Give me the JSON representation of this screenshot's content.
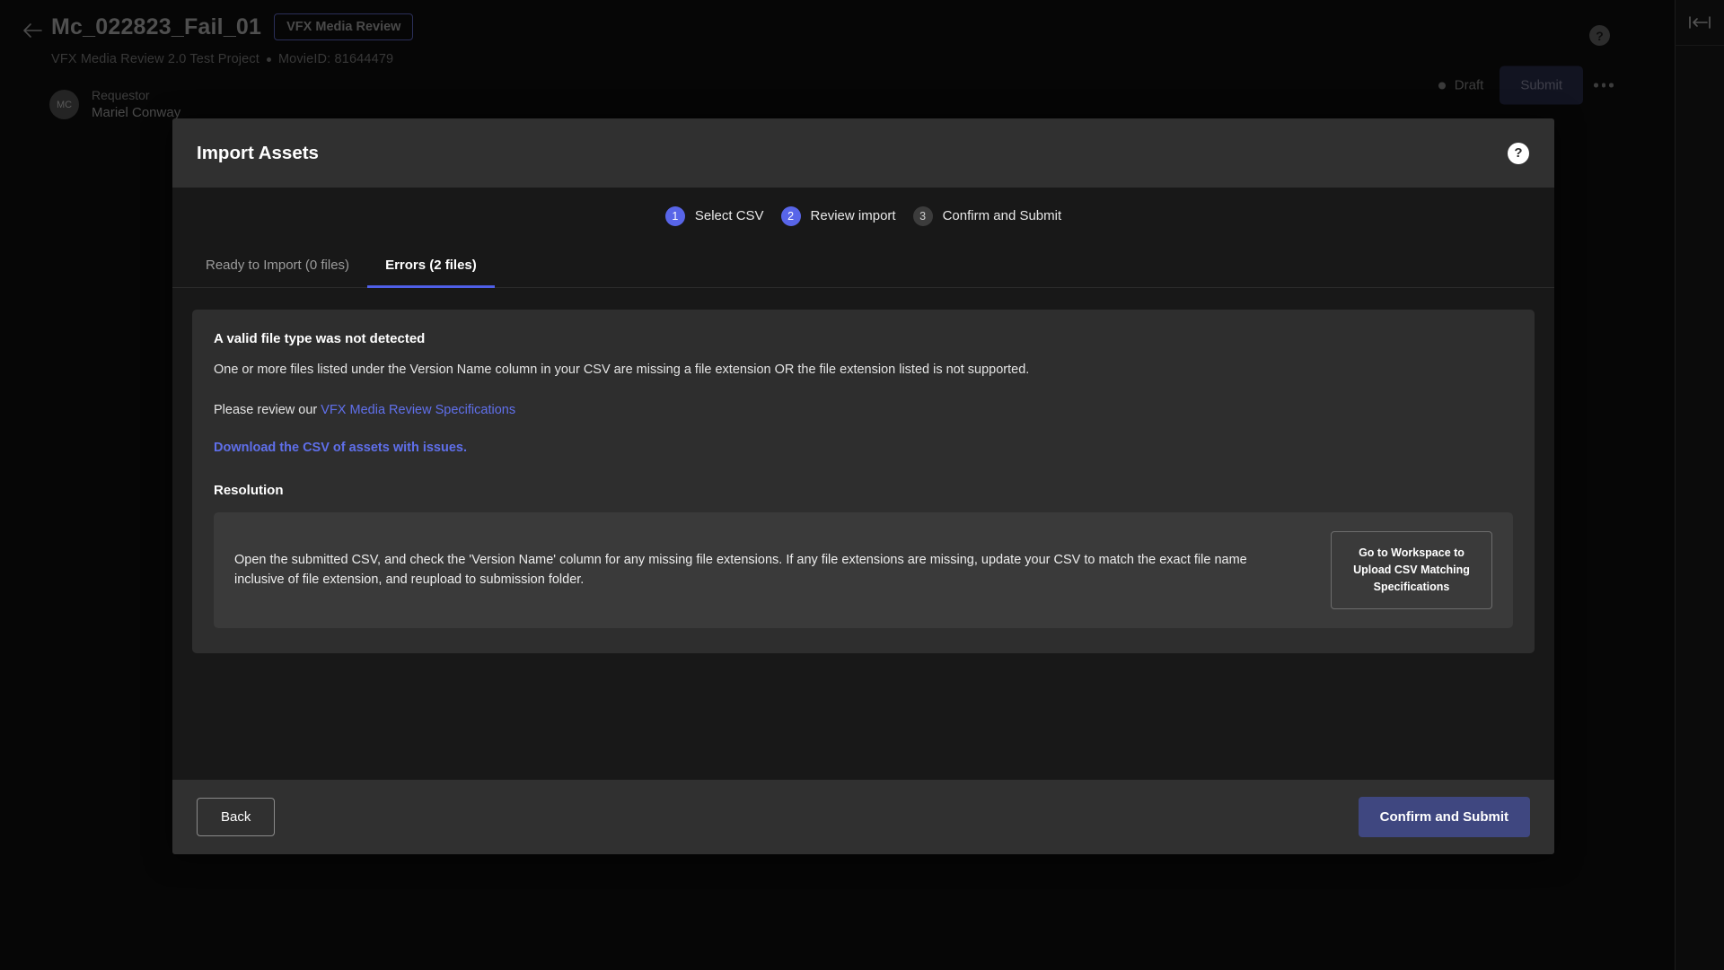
{
  "app": {
    "back_icon": "arrow-left-icon",
    "title": "Mc_022823_Fail_01",
    "chip": "VFX Media Review",
    "project": "VFX Media Review 2.0 Test Project",
    "movie_id": "MovieID: 81644479",
    "help_icon": "question-mark-icon",
    "rail_icon": "collapse-panel-icon",
    "requestor": {
      "label": "Requestor",
      "name": "Mariel Conway",
      "initials": "MC"
    },
    "actions": {
      "status": "Draft",
      "submit_label": "Submit",
      "overflow_icon": "more-horizontal-icon"
    }
  },
  "modal": {
    "title": "Import Assets",
    "help_icon": "question-mark-icon",
    "steps": [
      {
        "num": "1",
        "label": "Select CSV",
        "state": "active"
      },
      {
        "num": "2",
        "label": "Review import",
        "state": "active"
      },
      {
        "num": "3",
        "label": "Confirm and Submit",
        "state": "idle"
      }
    ],
    "tabs": [
      {
        "label": "Ready to Import (0 files)",
        "active": false
      },
      {
        "label": "Errors (2 files)",
        "active": true
      }
    ],
    "error": {
      "title": "A valid file type was not detected",
      "description": "One or more files listed under the Version Name column in your CSV are missing a file extension OR the file extension listed is not supported.",
      "review_prefix": "Please review our ",
      "review_link": "VFX Media Review Specifications",
      "download_link": "Download the CSV of assets with issues.",
      "resolution_title": "Resolution",
      "resolution_text": "Open the submitted CSV, and check the 'Version Name' column for any missing file extensions. If any file extensions are missing, update your CSV to match the exact file name inclusive of file extension, and reupload to submission folder.",
      "resolution_button": "Go to Workspace to Upload CSV Matching Specifications"
    },
    "footer": {
      "back_label": "Back",
      "confirm_label": "Confirm and Submit"
    }
  },
  "colors": {
    "accent": "#5865e8",
    "link": "#6070ec",
    "confirm": "#3f4780",
    "modal_header": "#303030",
    "panel": "#2e2e2e"
  }
}
